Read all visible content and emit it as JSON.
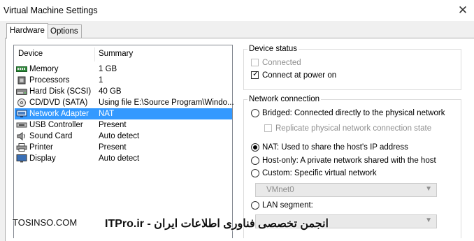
{
  "window": {
    "title": "Virtual Machine Settings"
  },
  "tabs": [
    {
      "label": "Hardware"
    },
    {
      "label": "Options"
    }
  ],
  "device_list": {
    "columns": {
      "device": "Device",
      "summary": "Summary"
    },
    "rows": [
      {
        "name": "Memory",
        "summary": "1 GB",
        "icon": "memory-icon"
      },
      {
        "name": "Processors",
        "summary": "1",
        "icon": "processor-icon"
      },
      {
        "name": "Hard Disk (SCSI)",
        "summary": "40 GB",
        "icon": "hard-disk-icon"
      },
      {
        "name": "CD/DVD (SATA)",
        "summary": "Using file E:\\Source Program\\Windo...",
        "icon": "cd-dvd-icon"
      },
      {
        "name": "Network Adapter",
        "summary": "NAT",
        "icon": "network-adapter-icon"
      },
      {
        "name": "USB Controller",
        "summary": "Present",
        "icon": "usb-icon"
      },
      {
        "name": "Sound Card",
        "summary": "Auto detect",
        "icon": "sound-card-icon"
      },
      {
        "name": "Printer",
        "summary": "Present",
        "icon": "printer-icon"
      },
      {
        "name": "Display",
        "summary": "Auto detect",
        "icon": "display-icon"
      }
    ],
    "selected_index": 4,
    "selected_color": "#3399ff"
  },
  "device_status": {
    "title": "Device status",
    "connected": {
      "label": "Connected",
      "checked": false,
      "enabled": false
    },
    "connect_at_power_on": {
      "label": "Connect at power on",
      "checked": true,
      "enabled": true
    }
  },
  "network_connection": {
    "title": "Network connection",
    "bridged": {
      "label": "Bridged: Connected directly to the physical network",
      "selected": false
    },
    "replicate": {
      "label": "Replicate physical network connection state",
      "checked": false,
      "enabled": false
    },
    "nat": {
      "label": "NAT: Used to share the host's IP address",
      "selected": true
    },
    "host_only": {
      "label": "Host-only: A private network shared with the host",
      "selected": false
    },
    "custom": {
      "label": "Custom: Specific virtual network",
      "selected": false
    },
    "custom_select": {
      "value": "VMnet0",
      "enabled": false
    },
    "lan_segment": {
      "label": "LAN segment:",
      "selected": false
    },
    "lan_select": {
      "value": "",
      "enabled": false
    }
  },
  "watermark": {
    "site": "TOSINSO.COM",
    "brand": "ITPro.ir - انجمن تخصصی فناوری اطلاعات ایران"
  }
}
